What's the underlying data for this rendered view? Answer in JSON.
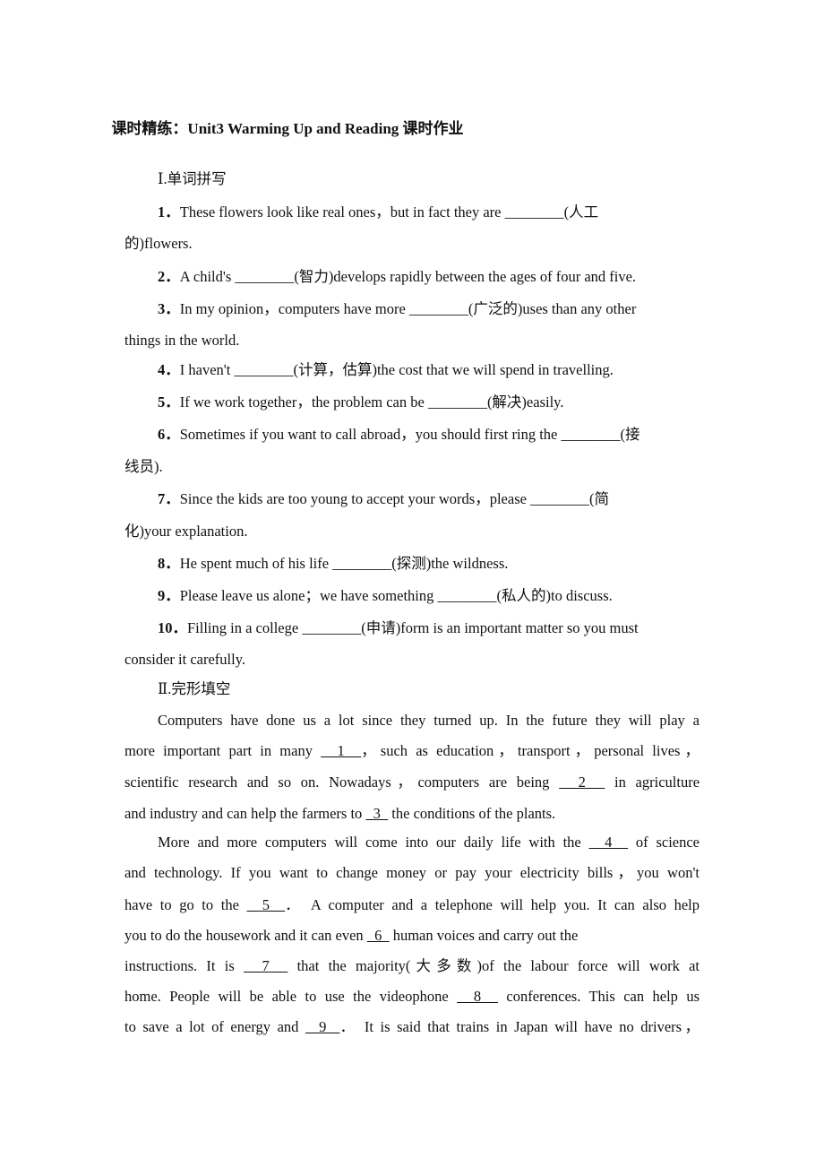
{
  "title": "课时精练：Unit3 Warming Up and Reading 课时作业",
  "section1": {
    "heading": "Ⅰ.单词拼写",
    "items": [
      {
        "num": "1．",
        "line1": "These flowers look like real ones，but in fact they are ________(人工",
        "line2": "的)flowers."
      },
      {
        "num": "2．",
        "line1": "A child's ________(智力)develops rapidly between the ages of four and five."
      },
      {
        "num": "3．",
        "line1": "In my opinion，computers have more ________(广泛的)uses than any other",
        "line2": "things in the world."
      },
      {
        "num": "4．",
        "line1": "I haven't ________(计算，估算)the cost that we will spend in travelling."
      },
      {
        "num": "5．",
        "line1": "If we work together，the problem can be ________(解决)easily."
      },
      {
        "num": "6．",
        "line1": "Sometimes if you want to call abroad，you should first ring the ________(接",
        "line2": "线员)."
      },
      {
        "num": "7．",
        "line1": "Since the kids are too young to accept your words，please ________(简",
        "line2": "化)your explanation."
      },
      {
        "num": "8．",
        "line1": "He spent much of his life ________(探测)the wildness."
      },
      {
        "num": "9．",
        "line1": "Please leave us alone；we have something ________(私人的)to discuss."
      },
      {
        "num": "10．",
        "line1": "Filling in a college ________(申请)form is an important matter so you must",
        "line2": "consider it carefully."
      }
    ]
  },
  "section2": {
    "heading": "Ⅱ.完形填空",
    "lines": [
      "Computers have done us a lot since they turned up. In the future they will play a",
      "more important part in many __1__，such as education，transport，personal lives，",
      "scientific research and so on. Nowadays，computers are being __2__ in agriculture",
      "and industry and can help the farmers to __3__ the conditions of the plants.",
      "More and more computers will come into our daily life with the __4__ of science",
      "and technology. If you want to change money or pay your electricity bills，you won't",
      "have to go to the __5__． A computer and a telephone will help you. It can also help",
      "you to do the housework and it can even __6__ human voices and carry out the",
      "instructions. It is __7__ that the majority(大多数)of the labour force will work at",
      "home. People will be able to use the videophone __8__ conferences. This can help us",
      "to save a lot of energy and __9__． It is said that trains in Japan will have no drivers，"
    ]
  }
}
